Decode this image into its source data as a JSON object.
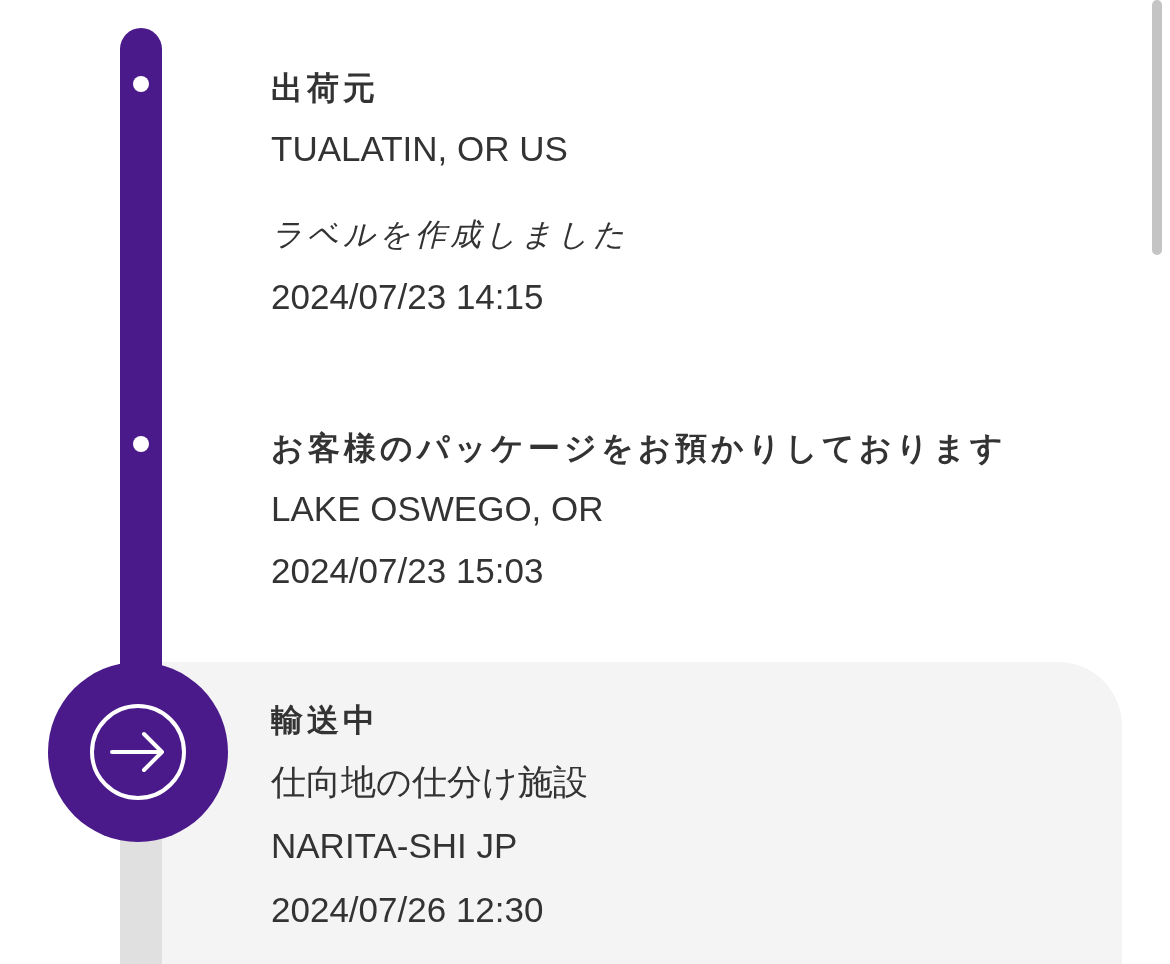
{
  "events": [
    {
      "title": "出荷元",
      "current": false,
      "lines": [
        {
          "kind": "location",
          "text": "TUALATIN, OR US"
        },
        {
          "kind": "note",
          "text": "ラベルを作成しました"
        },
        {
          "kind": "time",
          "text": "2024/07/23 14:15"
        }
      ]
    },
    {
      "title": "お客様のパッケージをお預かりしております",
      "current": false,
      "lines": [
        {
          "kind": "location",
          "text": "LAKE OSWEGO, OR"
        },
        {
          "kind": "time",
          "text": "2024/07/23 15:03"
        }
      ]
    },
    {
      "title": "輸送中",
      "current": true,
      "lines": [
        {
          "kind": "location",
          "text": "仕向地の仕分け施設"
        },
        {
          "kind": "location",
          "text": "NARITA-SHI JP"
        },
        {
          "kind": "time",
          "text": "2024/07/26 12:30"
        }
      ]
    }
  ]
}
